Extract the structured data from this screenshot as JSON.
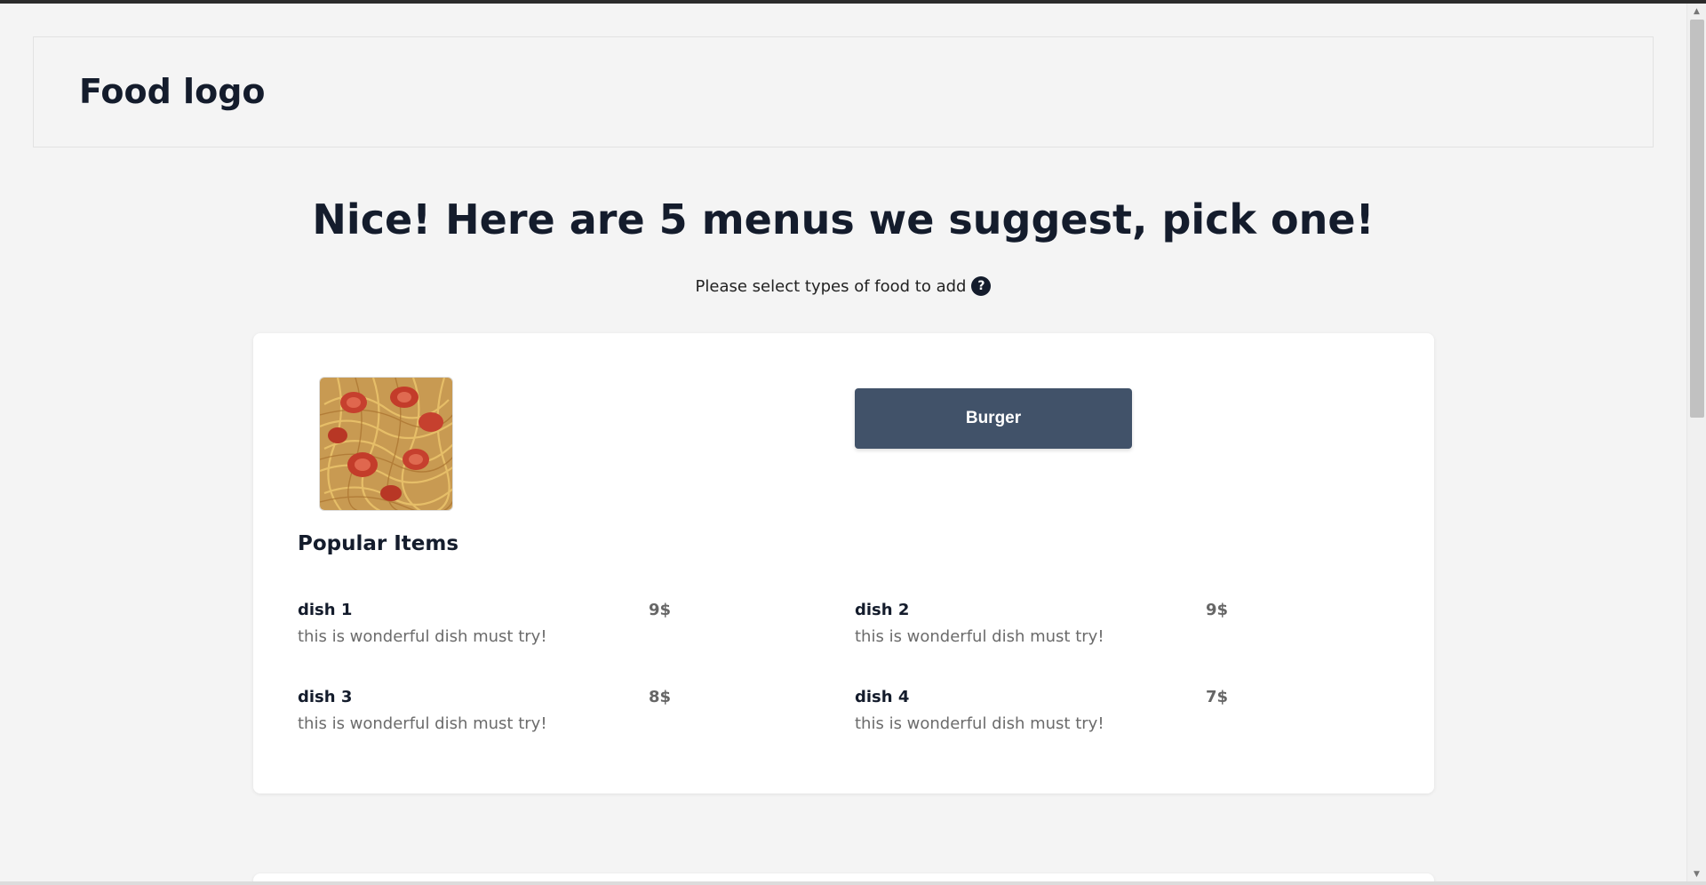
{
  "header": {
    "logo_text": "Food logo"
  },
  "hero": {
    "title": "Nice! Here are 5 menus we suggest, pick one!",
    "subtitle": "Please select types of food to add",
    "help_icon_glyph": "?"
  },
  "menu_card": {
    "image_icon": "pasta-photo",
    "category_button_label": "Burger",
    "section_title": "Popular Items",
    "dishes": [
      {
        "name": "dish 1",
        "price": "9$",
        "description": "this is wonderful dish must try!"
      },
      {
        "name": "dish 2",
        "price": "9$",
        "description": "this is wonderful dish must try!"
      },
      {
        "name": "dish 3",
        "price": "8$",
        "description": "this is wonderful dish must try!"
      },
      {
        "name": "dish 4",
        "price": "7$",
        "description": "this is wonderful dish must try!"
      }
    ]
  },
  "colors": {
    "page_background": "#f4f4f4",
    "heading_text": "#141c2c",
    "button_background": "#415269",
    "muted_text": "#6b6b6b"
  },
  "scrollbar": {
    "icon_up": "triangle-up",
    "icon_down": "triangle-down"
  }
}
